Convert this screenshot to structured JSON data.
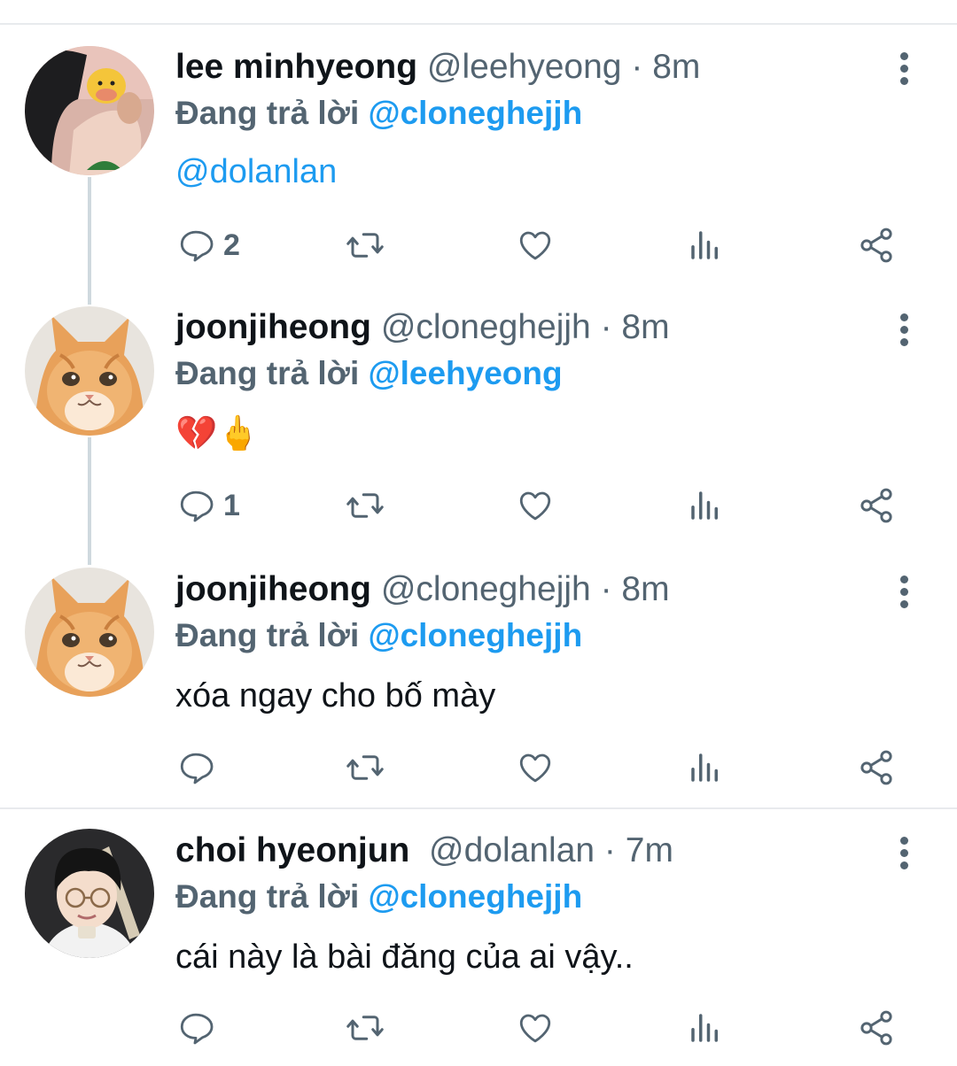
{
  "tweets": [
    {
      "name": "lee minhyeong",
      "handle": "@leehyeong",
      "sep": "·",
      "time": "8m",
      "replying_prefix": "Đang trả lời",
      "replying_to": "@cloneghejjh",
      "text": "@dolanlan",
      "reply_count": "2",
      "avatar": "boy-with-plush-avatar"
    },
    {
      "name": "joonjiheong",
      "handle": "@cloneghejjh",
      "sep": "·",
      "time": "8m",
      "replying_prefix": "Đang trả lời",
      "replying_to": "@leehyeong",
      "text": "💔🖕",
      "reply_count": "1",
      "avatar": "orange-cat-avatar"
    },
    {
      "name": "joonjiheong",
      "handle": "@cloneghejjh",
      "sep": "·",
      "time": "8m",
      "replying_prefix": "Đang trả lời",
      "replying_to": "@cloneghejjh",
      "text": "xóa ngay cho bố mày",
      "reply_count": "",
      "avatar": "orange-cat-avatar"
    },
    {
      "name": "choi hyeonjun",
      "handle": "@dolanlan",
      "sep": "·",
      "time": "7m",
      "replying_prefix": "Đang trả lời",
      "replying_to": "@cloneghejjh",
      "text": "cái này là bài đăng của ai vậy..",
      "reply_count": "",
      "avatar": "boy-with-glasses-avatar"
    }
  ],
  "colors": {
    "link": "#1d9bf0",
    "secondary": "#536471",
    "primary": "#0f1419",
    "divider": "#e8eaed",
    "thread_line": "#cfd9de"
  },
  "icons": [
    "reply-icon",
    "retweet-icon",
    "like-icon",
    "views-icon",
    "share-icon",
    "more-icon"
  ]
}
